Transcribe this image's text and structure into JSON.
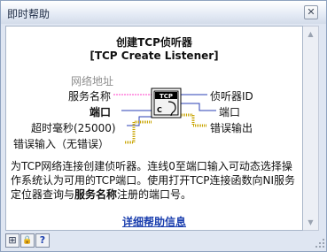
{
  "window": {
    "title": "即时帮助",
    "close_glyph": "✕"
  },
  "function": {
    "name_cn": "创建TCP侦听器",
    "name_en": "[TCP Create Listener]"
  },
  "terminals": {
    "inputs": {
      "net_address": "网络地址",
      "service_name": "服务名称",
      "port": "端口",
      "timeout": "超时毫秒(25000)",
      "error_in": "错误输入（无错误）"
    },
    "outputs": {
      "listener_id": "侦听器ID",
      "port": "端口",
      "error_out": "错误输出"
    }
  },
  "icon": {
    "top_label": "TCP",
    "corner_label": "C"
  },
  "description": {
    "part1": "为TCP网络连接创建侦听器。连线0至端口输入可动态选择操作系统认为可用的TCP端口。使用打开TCP连接函数向NI服务定位器查询与",
    "bold": "服务名称",
    "part2": "注册的端口号。"
  },
  "link_text": "详细帮助信息",
  "bottom_bar": {
    "buttons": [
      {
        "name": "show-optional-terminals-icon",
        "glyph": "⊞"
      },
      {
        "name": "lock-icon",
        "glyph": "🔒"
      },
      {
        "name": "help-icon",
        "glyph": "?"
      }
    ]
  },
  "colors": {
    "pink_wire": "#ff3fc8",
    "blue_wire": "#2a3fb4",
    "error_wire": "#c8a400",
    "link": "#1b3fae"
  }
}
